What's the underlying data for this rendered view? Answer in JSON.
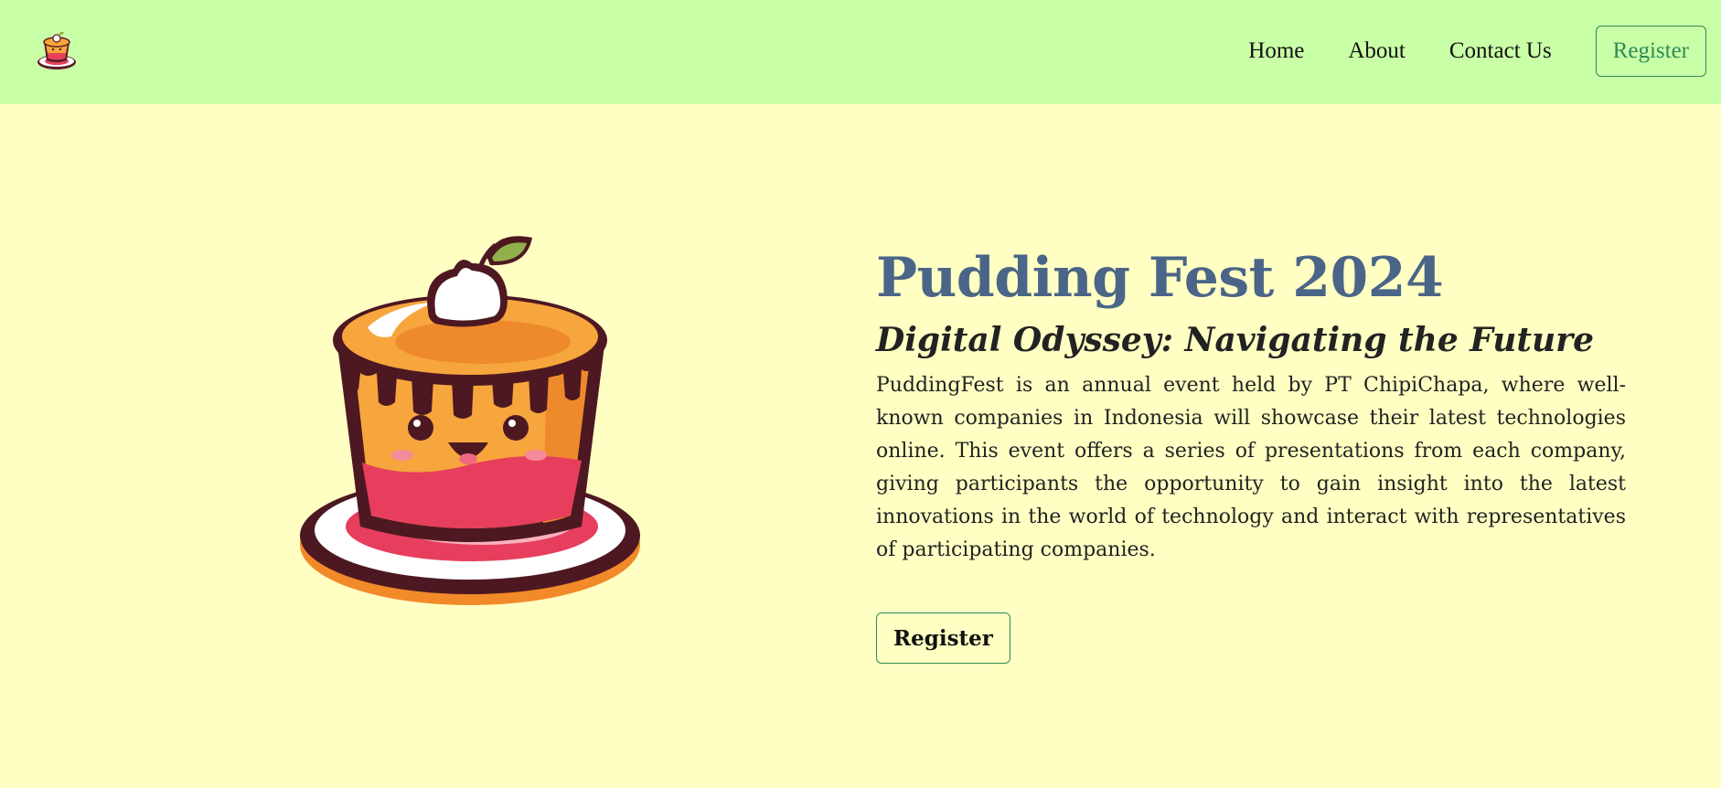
{
  "nav": {
    "logo_icon": "pudding-cake-icon",
    "links": [
      "Home",
      "About",
      "Contact Us"
    ],
    "register_label": "Register"
  },
  "hero": {
    "image_icon": "pudding-cake-illustration",
    "title": "Pudding Fest 2024",
    "subtitle": "Digital Odyssey: Navigating the Future",
    "description": "PuddingFest is an annual event held by PT ChipiChapa, where well-known companies in Indonesia will showcase their latest technologies online. This event offers a series of presentations from each company, giving participants the opportunity to gain insight into the latest innovations in the world of technology and interact with representatives of participating companies.",
    "cta_label": "Register"
  },
  "colors": {
    "navbar_bg": "#c9ffa7",
    "page_bg": "#ffffc3",
    "title": "#4a6587",
    "accent": "#2e8b57"
  }
}
